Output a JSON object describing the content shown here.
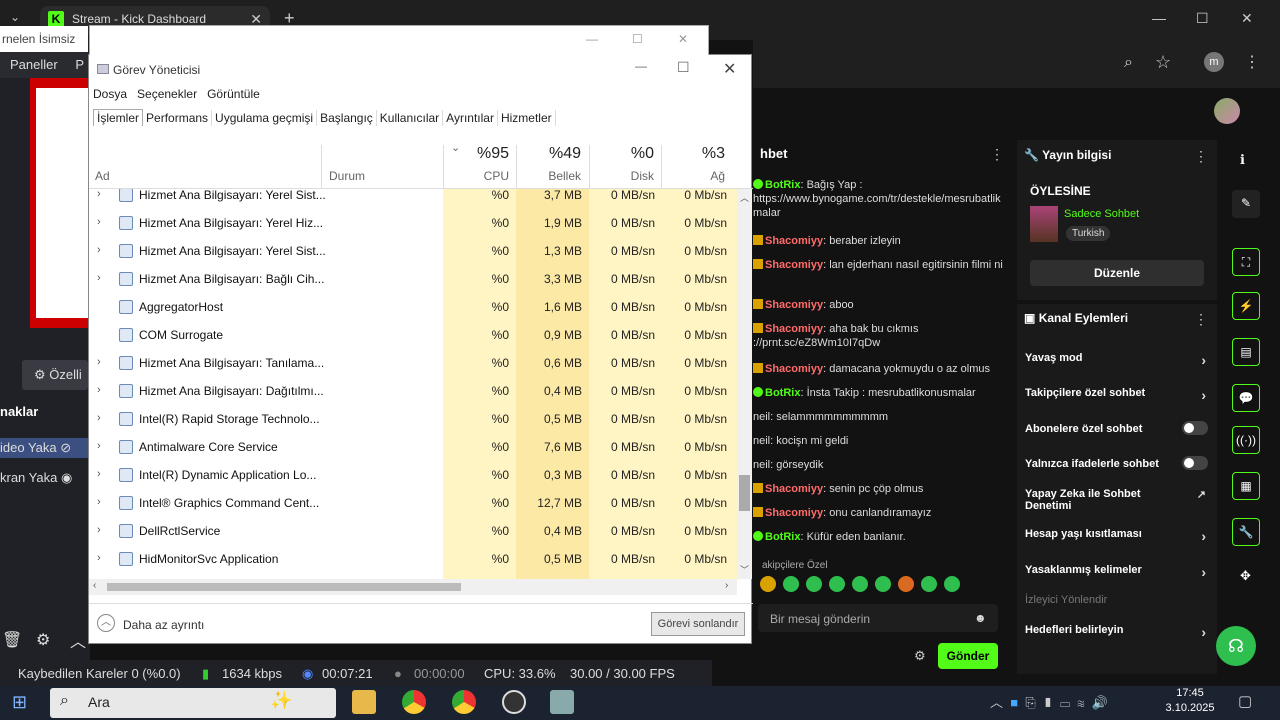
{
  "browser": {
    "tab_title": "Stream - Kick Dashboard",
    "logo_letter": "K",
    "new_tab": "+",
    "tabs_dropdown": "⌄",
    "profile_initial": "m"
  },
  "obs": {
    "name_bar": "rnelen İsimsiz",
    "panels_menu": "Paneller",
    "panels_menu_2": "P",
    "properties_button": "⚙ Özelli",
    "sources_header": "naklar",
    "sources": [
      "ideo Yaka",
      "kran Yaka"
    ],
    "status": {
      "dropped_frames": "Kaybedilen Kareler 0 (%0.0)",
      "bitrate": "1634 kbps",
      "stream_time": "00:07:21",
      "rec_time": "00:00:00",
      "cpu": "CPU: 33.6%",
      "fps": "30.00 / 30.00 FPS"
    }
  },
  "task_manager": {
    "title": "Görev Yöneticisi",
    "menu": [
      "Dosya",
      "Seçenekler",
      "Görüntüle"
    ],
    "tabs": [
      "İşlemler",
      "Performans",
      "Uygulama geçmişi",
      "Başlangıç",
      "Kullanıcılar",
      "Ayrıntılar",
      "Hizmetler"
    ],
    "columns": {
      "name": "Ad",
      "status": "Durum",
      "cpu_pct": "%95",
      "cpu": "CPU",
      "mem_pct": "%49",
      "mem": "Bellek",
      "disk_pct": "%0",
      "disk": "Disk",
      "net_pct": "%3",
      "net": "Ağ"
    },
    "rows": [
      {
        "name": "Hizmet Ana Bilgisayarı: Yerel Sist...",
        "cpu": "%0",
        "mem": "3,7 MB",
        "disk": "0 MB/sn",
        "net": "0 Mb/sn",
        "expand": "›"
      },
      {
        "name": "Hizmet Ana Bilgisayarı: Yerel Hiz...",
        "cpu": "%0",
        "mem": "1,9 MB",
        "disk": "0 MB/sn",
        "net": "0 Mb/sn",
        "expand": "›"
      },
      {
        "name": "Hizmet Ana Bilgisayarı: Yerel Sist...",
        "cpu": "%0",
        "mem": "1,3 MB",
        "disk": "0 MB/sn",
        "net": "0 Mb/sn",
        "expand": "›"
      },
      {
        "name": "Hizmet Ana Bilgisayarı: Bağlı Cih...",
        "cpu": "%0",
        "mem": "3,3 MB",
        "disk": "0 MB/sn",
        "net": "0 Mb/sn",
        "expand": "›"
      },
      {
        "name": "AggregatorHost",
        "cpu": "%0",
        "mem": "1,6 MB",
        "disk": "0 MB/sn",
        "net": "0 Mb/sn",
        "expand": ""
      },
      {
        "name": "COM Surrogate",
        "cpu": "%0",
        "mem": "0,9 MB",
        "disk": "0 MB/sn",
        "net": "0 Mb/sn",
        "expand": ""
      },
      {
        "name": "Hizmet Ana Bilgisayarı: Tanılama...",
        "cpu": "%0",
        "mem": "0,6 MB",
        "disk": "0 MB/sn",
        "net": "0 Mb/sn",
        "expand": "›"
      },
      {
        "name": "Hizmet Ana Bilgisayarı: Dağıtılmı...",
        "cpu": "%0",
        "mem": "0,4 MB",
        "disk": "0 MB/sn",
        "net": "0 Mb/sn",
        "expand": "›"
      },
      {
        "name": "Intel(R) Rapid Storage Technolo...",
        "cpu": "%0",
        "mem": "0,5 MB",
        "disk": "0 MB/sn",
        "net": "0 Mb/sn",
        "expand": "›"
      },
      {
        "name": "Antimalware Core Service",
        "cpu": "%0",
        "mem": "7,6 MB",
        "disk": "0 MB/sn",
        "net": "0 Mb/sn",
        "expand": "›"
      },
      {
        "name": "Intel(R) Dynamic Application Lo...",
        "cpu": "%0",
        "mem": "0,3 MB",
        "disk": "0 MB/sn",
        "net": "0 Mb/sn",
        "expand": "›"
      },
      {
        "name": "Intel® Graphics Command Cent...",
        "cpu": "%0",
        "mem": "12,7 MB",
        "disk": "0 MB/sn",
        "net": "0 Mb/sn",
        "expand": "›"
      },
      {
        "name": "DellRctlService",
        "cpu": "%0",
        "mem": "0,4 MB",
        "disk": "0 MB/sn",
        "net": "0 Mb/sn",
        "expand": "›"
      },
      {
        "name": "HidMonitorSvc Application",
        "cpu": "%0",
        "mem": "0,5 MB",
        "disk": "0 MB/sn",
        "net": "0 Mb/sn",
        "expand": "›"
      }
    ],
    "fewer_details": "Daha az ayrıntı",
    "end_task": "Görevi sonlandır"
  },
  "chat": {
    "header": "hbet",
    "messages": [
      {
        "user": "BotRix",
        "text": ": Bağış Yap : https://www.bynogame.com/tr/destekle/mesrubatlik malar",
        "bot": true
      },
      {
        "user": "Shacomiyy",
        "text": ": beraber izleyin",
        "bot": false
      },
      {
        "user": "Shacomiyy",
        "text": ": lan ejderhanı nasıl egitirsinin filmi ni",
        "bot": false
      },
      {
        "user": "Shacomiyy",
        "text": ": aboo",
        "bot": false
      },
      {
        "user": "Shacomiyy",
        "text": ": aha bak bu cıkmıs ://prnt.sc/eZ8Wm10I7qDw",
        "bot": false
      },
      {
        "user": "Shacomiyy",
        "text": ": damacana yokmuydu o az olmus",
        "bot": false
      },
      {
        "user": "BotRix",
        "text": ": İnsta Takip : mesrubatlikonusmalar",
        "bot": true
      },
      {
        "user": "neil",
        "text": ": selammmmmmmmmm",
        "bot": false,
        "plain": true
      },
      {
        "user": "neil",
        "text": ": kocişn mi geldi",
        "bot": false,
        "plain": true
      },
      {
        "user": "neil",
        "text": ": görseydik",
        "bot": false,
        "plain": true
      },
      {
        "user": "Shacomiyy",
        "text": ": senin pc çöp olmus",
        "bot": false
      },
      {
        "user": "Shacomiyy",
        "text": ": onu canlandıramayız",
        "bot": false
      },
      {
        "user": "BotRix",
        "text": ": Küfür eden banlanır.",
        "bot": true
      }
    ],
    "followers_only": "akipçilere Özel",
    "input_placeholder": "Bir mesaj gönderin",
    "send": "Gönder"
  },
  "stream_info": {
    "header": "Yayın bilgisi",
    "title": "ÖYLESİNE",
    "category": "Sadece Sohbet",
    "language": "Turkish",
    "edit": "Düzenle"
  },
  "channel_actions": {
    "header": "Kanal Eylemleri",
    "items": [
      {
        "label": "Yavaş mod",
        "kind": "chevron"
      },
      {
        "label": "Takipçilere özel sohbet",
        "kind": "chevron"
      },
      {
        "label": "Abonelere özel sohbet",
        "kind": "toggle"
      },
      {
        "label": "Yalnızca ifadelerle sohbet",
        "kind": "toggle"
      },
      {
        "label": "Yapay Zeka ile Sohbet Denetimi",
        "kind": "link"
      },
      {
        "label": "Hesap yaşı kısıtlaması",
        "kind": "chevron"
      },
      {
        "label": "Yasaklanmış kelimeler",
        "kind": "chevron"
      },
      {
        "label": "İzleyici Yönlendir",
        "kind": "dim"
      },
      {
        "label": "Hedefleri belirleyin",
        "kind": "chevron"
      }
    ]
  },
  "taskbar": {
    "search": "Ara",
    "time": "17:45",
    "date": "3.10.2025"
  },
  "colors": {
    "kick_green": "#53fc18",
    "cpu_highlight": "#fff4c4",
    "mem_highlight": "#fde9a6"
  }
}
